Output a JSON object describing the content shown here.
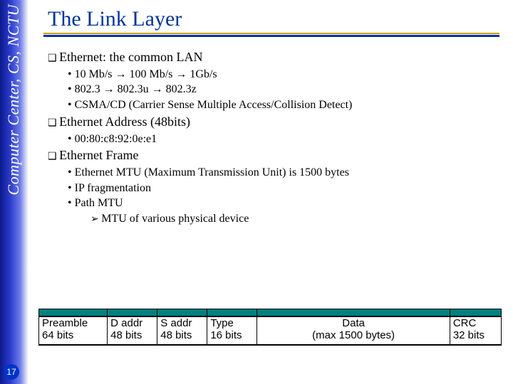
{
  "sidebar": {
    "label": "Computer Center, CS, NCTU"
  },
  "title": "The Link Layer",
  "sections": [
    {
      "heading": "Ethernet: the common LAN",
      "bullets": [
        "10 Mb/s → 100 Mb/s → 1Gb/s",
        "802.3 → 802.3u → 802.3z",
        "CSMA/CD  (Carrier Sense Multiple Access/Collision Detect)"
      ]
    },
    {
      "heading": "Ethernet Address (48bits)",
      "bullets": [
        "00:80:c8:92:0e:e1"
      ]
    },
    {
      "heading": "Ethernet Frame",
      "bullets": [
        "Ethernet MTU (Maximum Transmission Unit) is 1500 bytes",
        "IP fragmentation",
        "Path MTU"
      ],
      "sub": [
        "MTU of various physical device"
      ]
    }
  ],
  "frame": {
    "fields": [
      {
        "name": "Preamble",
        "size": "64 bits"
      },
      {
        "name": "D addr",
        "size": "48 bits"
      },
      {
        "name": "S addr",
        "size": "48 bits"
      },
      {
        "name": "Type",
        "size": "16 bits"
      },
      {
        "name": "Data",
        "size": "(max 1500 bytes)"
      },
      {
        "name": "CRC",
        "size": "32 bits"
      }
    ]
  },
  "page": "17"
}
